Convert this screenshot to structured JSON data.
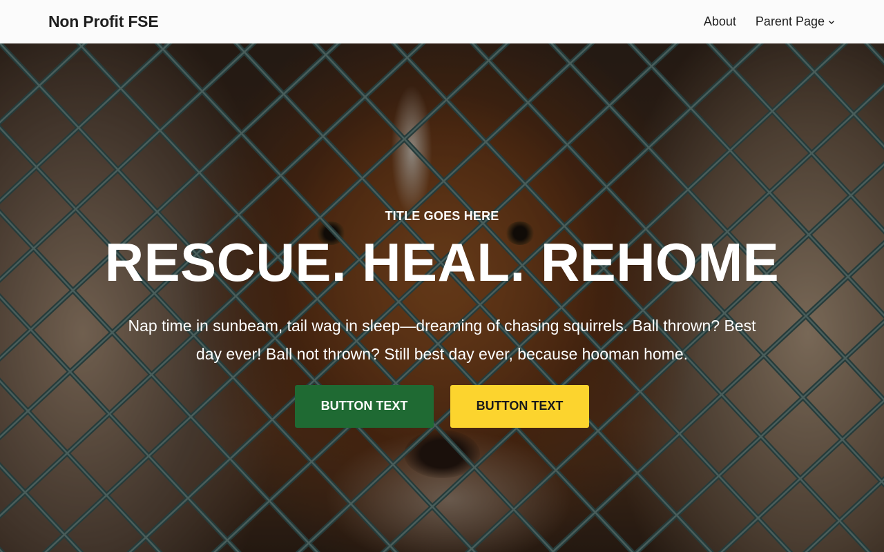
{
  "header": {
    "site_title": "Non Profit FSE",
    "nav": [
      {
        "label": "About",
        "has_submenu": false
      },
      {
        "label": "Parent Page",
        "has_submenu": true
      }
    ]
  },
  "hero": {
    "kicker": "TITLE GOES HERE",
    "headline": "RESCUE. HEAL. REHOME",
    "lede": "Nap time in sunbeam, tail wag in sleep—dreaming of chasing squirrels. Ball thrown? Best day ever! Ball not thrown? Still best day ever, because hooman home.",
    "buttons": [
      {
        "label": "BUTTON TEXT",
        "style": "primary"
      },
      {
        "label": "BUTTON TEXT",
        "style": "secondary"
      }
    ]
  },
  "colors": {
    "header_bg": "#fbfbfb",
    "primary_button": "#1f6a33",
    "secondary_button": "#fcd42e",
    "text_light": "#ffffff"
  }
}
